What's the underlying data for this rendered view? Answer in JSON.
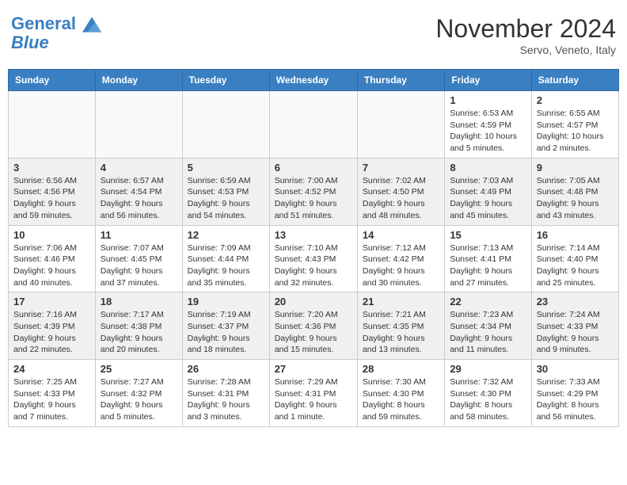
{
  "header": {
    "logo_line1": "General",
    "logo_line2": "Blue",
    "month": "November 2024",
    "location": "Servo, Veneto, Italy"
  },
  "days_of_week": [
    "Sunday",
    "Monday",
    "Tuesday",
    "Wednesday",
    "Thursday",
    "Friday",
    "Saturday"
  ],
  "weeks": [
    [
      {
        "day": "",
        "info": ""
      },
      {
        "day": "",
        "info": ""
      },
      {
        "day": "",
        "info": ""
      },
      {
        "day": "",
        "info": ""
      },
      {
        "day": "",
        "info": ""
      },
      {
        "day": "1",
        "info": "Sunrise: 6:53 AM\nSunset: 4:59 PM\nDaylight: 10 hours\nand 5 minutes."
      },
      {
        "day": "2",
        "info": "Sunrise: 6:55 AM\nSunset: 4:57 PM\nDaylight: 10 hours\nand 2 minutes."
      }
    ],
    [
      {
        "day": "3",
        "info": "Sunrise: 6:56 AM\nSunset: 4:56 PM\nDaylight: 9 hours\nand 59 minutes."
      },
      {
        "day": "4",
        "info": "Sunrise: 6:57 AM\nSunset: 4:54 PM\nDaylight: 9 hours\nand 56 minutes."
      },
      {
        "day": "5",
        "info": "Sunrise: 6:59 AM\nSunset: 4:53 PM\nDaylight: 9 hours\nand 54 minutes."
      },
      {
        "day": "6",
        "info": "Sunrise: 7:00 AM\nSunset: 4:52 PM\nDaylight: 9 hours\nand 51 minutes."
      },
      {
        "day": "7",
        "info": "Sunrise: 7:02 AM\nSunset: 4:50 PM\nDaylight: 9 hours\nand 48 minutes."
      },
      {
        "day": "8",
        "info": "Sunrise: 7:03 AM\nSunset: 4:49 PM\nDaylight: 9 hours\nand 45 minutes."
      },
      {
        "day": "9",
        "info": "Sunrise: 7:05 AM\nSunset: 4:48 PM\nDaylight: 9 hours\nand 43 minutes."
      }
    ],
    [
      {
        "day": "10",
        "info": "Sunrise: 7:06 AM\nSunset: 4:46 PM\nDaylight: 9 hours\nand 40 minutes."
      },
      {
        "day": "11",
        "info": "Sunrise: 7:07 AM\nSunset: 4:45 PM\nDaylight: 9 hours\nand 37 minutes."
      },
      {
        "day": "12",
        "info": "Sunrise: 7:09 AM\nSunset: 4:44 PM\nDaylight: 9 hours\nand 35 minutes."
      },
      {
        "day": "13",
        "info": "Sunrise: 7:10 AM\nSunset: 4:43 PM\nDaylight: 9 hours\nand 32 minutes."
      },
      {
        "day": "14",
        "info": "Sunrise: 7:12 AM\nSunset: 4:42 PM\nDaylight: 9 hours\nand 30 minutes."
      },
      {
        "day": "15",
        "info": "Sunrise: 7:13 AM\nSunset: 4:41 PM\nDaylight: 9 hours\nand 27 minutes."
      },
      {
        "day": "16",
        "info": "Sunrise: 7:14 AM\nSunset: 4:40 PM\nDaylight: 9 hours\nand 25 minutes."
      }
    ],
    [
      {
        "day": "17",
        "info": "Sunrise: 7:16 AM\nSunset: 4:39 PM\nDaylight: 9 hours\nand 22 minutes."
      },
      {
        "day": "18",
        "info": "Sunrise: 7:17 AM\nSunset: 4:38 PM\nDaylight: 9 hours\nand 20 minutes."
      },
      {
        "day": "19",
        "info": "Sunrise: 7:19 AM\nSunset: 4:37 PM\nDaylight: 9 hours\nand 18 minutes."
      },
      {
        "day": "20",
        "info": "Sunrise: 7:20 AM\nSunset: 4:36 PM\nDaylight: 9 hours\nand 15 minutes."
      },
      {
        "day": "21",
        "info": "Sunrise: 7:21 AM\nSunset: 4:35 PM\nDaylight: 9 hours\nand 13 minutes."
      },
      {
        "day": "22",
        "info": "Sunrise: 7:23 AM\nSunset: 4:34 PM\nDaylight: 9 hours\nand 11 minutes."
      },
      {
        "day": "23",
        "info": "Sunrise: 7:24 AM\nSunset: 4:33 PM\nDaylight: 9 hours\nand 9 minutes."
      }
    ],
    [
      {
        "day": "24",
        "info": "Sunrise: 7:25 AM\nSunset: 4:33 PM\nDaylight: 9 hours\nand 7 minutes."
      },
      {
        "day": "25",
        "info": "Sunrise: 7:27 AM\nSunset: 4:32 PM\nDaylight: 9 hours\nand 5 minutes."
      },
      {
        "day": "26",
        "info": "Sunrise: 7:28 AM\nSunset: 4:31 PM\nDaylight: 9 hours\nand 3 minutes."
      },
      {
        "day": "27",
        "info": "Sunrise: 7:29 AM\nSunset: 4:31 PM\nDaylight: 9 hours\nand 1 minute."
      },
      {
        "day": "28",
        "info": "Sunrise: 7:30 AM\nSunset: 4:30 PM\nDaylight: 8 hours\nand 59 minutes."
      },
      {
        "day": "29",
        "info": "Sunrise: 7:32 AM\nSunset: 4:30 PM\nDaylight: 8 hours\nand 58 minutes."
      },
      {
        "day": "30",
        "info": "Sunrise: 7:33 AM\nSunset: 4:29 PM\nDaylight: 8 hours\nand 56 minutes."
      }
    ]
  ]
}
